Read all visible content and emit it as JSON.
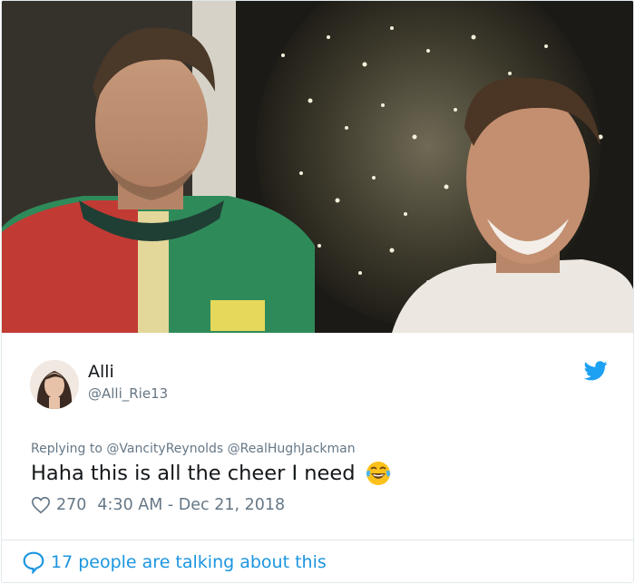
{
  "user": {
    "display_name": "Alli",
    "handle": "@Alli_Rie13"
  },
  "tweet": {
    "replying_label": "Replying to",
    "mentions": [
      "@VancityReynolds",
      "@RealHughJackman"
    ],
    "text": "Haha this is all the cheer I need",
    "emoji": "face-with-tears-of-joy-icon",
    "likes": "270",
    "timestamp": "4:30 AM - Dec 21, 2018"
  },
  "footer": {
    "talking_text": "17 people are talking about this"
  },
  "icons": {
    "brand": "twitter-bird-icon",
    "like": "heart-icon",
    "conversation": "speech-bubble-icon"
  },
  "colors": {
    "twitter_blue": "#1da1f2",
    "link_blue": "#1b95e0",
    "muted_gray": "#657786",
    "text_dark": "#14171a"
  }
}
